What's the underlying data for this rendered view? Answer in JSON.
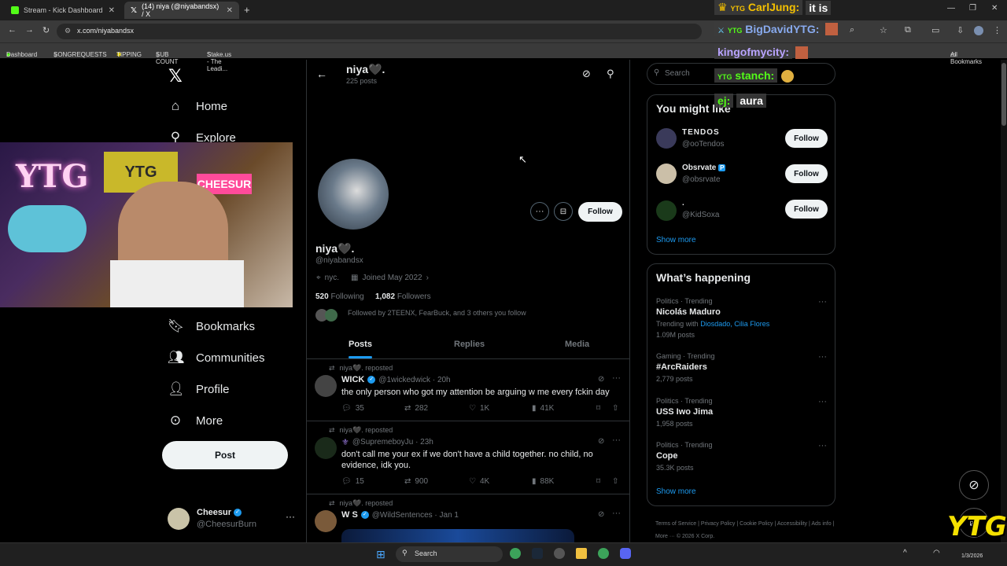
{
  "browser": {
    "tabs": [
      {
        "label": "Stream - Kick Dashboard",
        "active": false
      },
      {
        "label": "(14) niya    (@niyabandsx) / X",
        "active": true
      }
    ],
    "url": "x.com/niyabandsx",
    "bookmarks": [
      "Dashboard",
      "SONGREQUESTS",
      "TIPPING",
      "SUB COUNT",
      "Stake.us - The Leadi..."
    ],
    "all_bookmarks": "All Bookmarks"
  },
  "chat": [
    {
      "user": "CarlJung:",
      "msg": "it is"
    },
    {
      "user": "BigDavidYTG:",
      "msg": ""
    },
    {
      "user": "kingofmycity:",
      "msg": ""
    },
    {
      "user": "stanch:",
      "msg": ""
    },
    {
      "user": "ej:",
      "msg": "aura"
    }
  ],
  "nav": {
    "home": "Home",
    "explore": "Explore",
    "bookmarks": "Bookmarks",
    "communities": "Communities",
    "profile": "Profile",
    "more": "More",
    "post": "Post"
  },
  "account": {
    "name": "Cheesur",
    "handle": "@CheesurBurn"
  },
  "webcam": {
    "sign_left": "YTG",
    "sign_right": "YTG",
    "banner": "CHEESUR"
  },
  "profile": {
    "header_name": "niya🖤.",
    "post_count": "225 posts",
    "name": "niya🖤.",
    "handle": "@niyabandsx",
    "location": "nyc.",
    "joined": "Joined May 2022",
    "following_count": "520",
    "following_label": "Following",
    "followers_count": "1,082",
    "followers_label": "Followers",
    "followed_by": "Followed by 2TEENX, FearBuck, and 3 others you follow",
    "follow_button": "Follow"
  },
  "tabs": [
    "Posts",
    "Replies",
    "Media"
  ],
  "tweets": [
    {
      "repost_label": "niya🖤. reposted",
      "name": "WICK",
      "handle": "@1wickedwick · 20h",
      "text": "the only person who got my attention be arguing w me every fckin day",
      "replies": "35",
      "reposts": "282",
      "likes": "1K",
      "views": "41K"
    },
    {
      "repost_label": "niya🖤. reposted",
      "name": "⚜",
      "handle": "@SupremeboyJu · 23h",
      "text": "don't call me your ex if we don't have a child together. no child, no evidence, idk you.",
      "replies": "15",
      "reposts": "900",
      "likes": "4K",
      "views": "88K"
    },
    {
      "repost_label": "niya🖤. reposted",
      "name": "W S",
      "handle": "@WildSentences · Jan 1",
      "text": ""
    }
  ],
  "search": {
    "placeholder": "Search"
  },
  "might_like": {
    "title": "You might like",
    "users": [
      {
        "name": "TENDOS",
        "handle": "@ooTendos",
        "follow": "Follow"
      },
      {
        "name": "Obsrvate",
        "handle": "@obsrvate",
        "follow": "Follow"
      },
      {
        "name": ".",
        "handle": "@KidSoxa",
        "follow": "Follow"
      }
    ],
    "show_more": "Show more"
  },
  "happening": {
    "title": "What’s happening",
    "trends": [
      {
        "context": "Politics · Trending",
        "name": "Nicolás Maduro",
        "extra": "Trending with",
        "links": "Diosdado, Cilia Flores",
        "count": "1.09M posts"
      },
      {
        "context": "Gaming · Trending",
        "name": "#ArcRaiders",
        "extra": "",
        "links": "",
        "count": "2,779 posts"
      },
      {
        "context": "Politics · Trending",
        "name": "USS Iwo Jima",
        "extra": "",
        "links": "",
        "count": "1,958 posts"
      },
      {
        "context": "Politics · Trending",
        "name": "Cope",
        "extra": "",
        "links": "",
        "count": "35.3K posts"
      }
    ],
    "show_more": "Show more"
  },
  "footer": [
    "Terms of Service",
    "Privacy Policy",
    "Cookie Policy",
    "Accessibility",
    "Ads info",
    "More ···",
    "© 2026 X Corp."
  ],
  "overlay_logo": "YTG",
  "taskbar": {
    "search": "Search",
    "date": "1/3/2026"
  },
  "colors": {
    "accent": "#1d9bf0",
    "kick_green": "#53fc18",
    "ytg_yellow": "#f4e000"
  }
}
